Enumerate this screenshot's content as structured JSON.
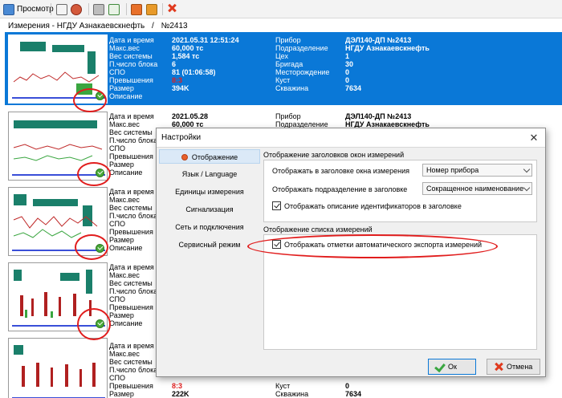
{
  "toolbar": {
    "view_label": "Просмотр"
  },
  "breadcrumb": [
    "Измерения - НГДУ Азнакаевскнефть",
    "/",
    "№2413"
  ],
  "field_labels_left": [
    "Дата и время",
    "Макс.вес",
    "Вес системы",
    "П.число блока",
    "СПО",
    "Превышения",
    "Размер",
    "Описание"
  ],
  "field_labels_right": [
    "Прибор",
    "Подразделение",
    "Цех",
    "Бригада",
    "Месторождение",
    "Куст",
    "Скважина"
  ],
  "records": [
    {
      "left": [
        "2021.05.31 12:51:24",
        "60,000 тс",
        "1,584 тс",
        "6",
        "81 (01:06:58)",
        "8:3",
        "394K",
        ""
      ],
      "right": [
        "ДЭЛ140-ДП №2413",
        "НГДУ Азнакаевскнефть",
        "1",
        "30",
        "0",
        "0",
        "7634"
      ]
    },
    {
      "left": [
        "2021.05.28",
        "60,000 тс",
        "",
        "",
        "",
        "",
        "",
        ""
      ],
      "right": [
        "ДЭЛ140-ДП №2413",
        "НГДУ Азнакаевскнефть",
        "",
        "",
        "",
        "",
        ""
      ]
    },
    {
      "left": [
        "",
        "",
        "",
        "",
        "",
        "",
        "",
        ""
      ],
      "right": [
        "",
        "",
        "",
        "",
        "",
        "",
        ""
      ]
    },
    {
      "left": [
        "",
        "",
        "",
        "",
        "",
        "",
        "",
        ""
      ],
      "right": [
        "",
        "",
        "",
        "",
        "",
        "",
        ""
      ]
    },
    {
      "left": [
        "",
        "",
        "",
        "",
        "",
        "8:3",
        "222K",
        ""
      ],
      "right": [
        "",
        "",
        "",
        "",
        "",
        "0",
        "7634"
      ]
    }
  ],
  "dialog": {
    "title": "Настройки",
    "nav": [
      "Отображение",
      "Язык / Language",
      "Единицы измерения",
      "Сигнализация",
      "Сеть и подключения",
      "Сервисный режим"
    ],
    "group1": {
      "title": "Отображение заголовков окон измерений",
      "opt1_label": "Отображать в заголовке окна измерения",
      "opt1_value": "Номер прибора",
      "opt2_label": "Отображать подразделение в заголовке",
      "opt2_value": "Сокращенное наименование",
      "check_label": "Отображать описание идентификаторов в заголовке"
    },
    "group2": {
      "title": "Отображение списка измерений",
      "check_label": "Отображать отметки автоматического экспорта измерений"
    },
    "ok_label": "Ок",
    "cancel_label": "Отмена"
  },
  "colors": {
    "selection": "#0a78d7",
    "annotation": "#e11d1d",
    "alert": "#e02020"
  }
}
